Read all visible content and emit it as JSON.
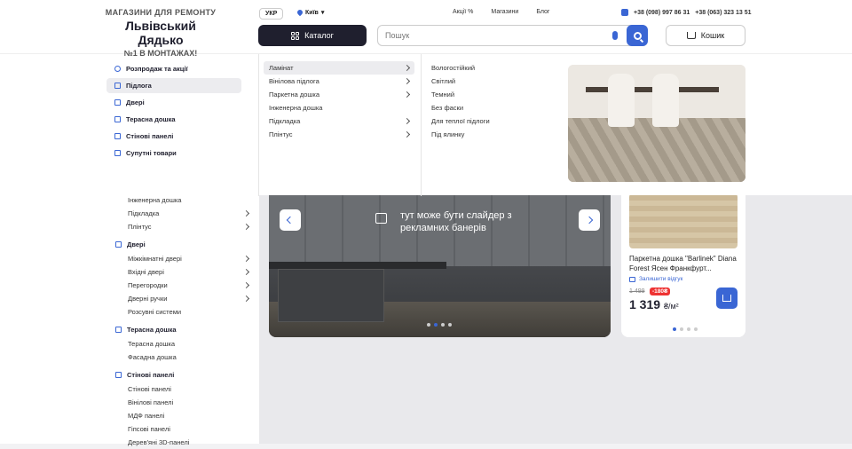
{
  "header": {
    "logo": {
      "line1": "МАГАЗИНИ ДЛЯ РЕМОНТУ",
      "line2": "Львівський Дядько",
      "line3": "№1 В МОНТАЖАХ!"
    },
    "lang": "УКР",
    "city": "Київ",
    "links": [
      "Акції %",
      "Магазини",
      "Блог"
    ],
    "phones": [
      "+38 (098) 997 86 31",
      "+38 (063) 323 13 51"
    ],
    "catalog_label": "Каталог",
    "search_placeholder": "Пошук",
    "cart_label": "Кошик"
  },
  "mega": {
    "col1": [
      "Розпродаж та акції",
      "Підлога",
      "Двері",
      "Терасна дошка",
      "Стінові панелі",
      "Супутні товари"
    ],
    "col2": [
      "Ламінат",
      "Вінілова підлога",
      "Паркетна дошка",
      "Інженерна дошка",
      "Підкладка",
      "Плінтус"
    ],
    "col3": [
      "Вологостійкий",
      "Світлий",
      "Темний",
      "Без фаски",
      "Для теплої підлоги",
      "Під ялинку"
    ]
  },
  "sidebar": {
    "floor_tail": [
      "Інженерна дошка",
      "Підкладка",
      "Плінтус"
    ],
    "doors": {
      "title": "Двері",
      "items": [
        "Міжкімнатні двері",
        "Вхідні двері",
        "Перегородки",
        "Дверні ручки",
        "Розсувні системи"
      ]
    },
    "terrace": {
      "title": "Терасна дошка",
      "items": [
        "Терасна дошка",
        "Фасадна дошка"
      ]
    },
    "panels": {
      "title": "Стінові панелі",
      "items": [
        "Стінові панелі",
        "Вінілові панелі",
        "МДФ панелі",
        "Гіпсові панелі",
        "Дерев'яні 3D-панелі"
      ]
    }
  },
  "banner": {
    "text": "тут може бути слайдер з рекламних банерів"
  },
  "product": {
    "name": "Паркетна дошка \"Barlinek\" Diana Forest Ясен Франкфурт...",
    "review": "Залишити відгук",
    "old_price": "1 499",
    "discount": "-180₴",
    "price": "1 319",
    "unit": "₴/м²"
  }
}
